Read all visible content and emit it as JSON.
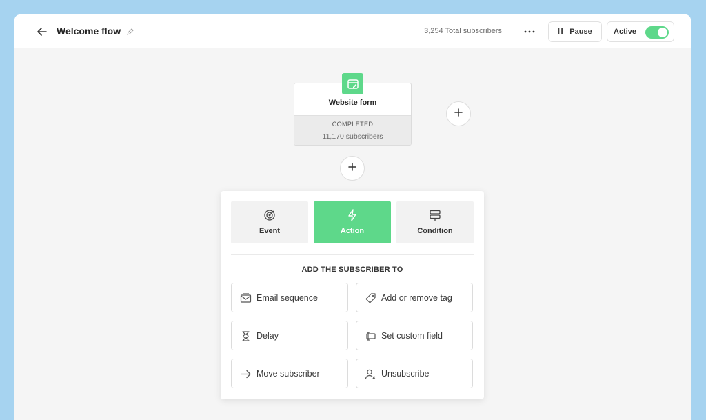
{
  "header": {
    "title": "Welcome flow",
    "subscribers_total": "3,254 Total subscribers",
    "pause_label": "Pause",
    "active_label": "Active",
    "active_on": true
  },
  "trigger": {
    "title": "Website form",
    "status": "COMPLETED",
    "count": "11,170 subscribers"
  },
  "panel": {
    "tabs": [
      {
        "label": "Event",
        "icon": "target-icon",
        "selected": false
      },
      {
        "label": "Action",
        "icon": "lightning-icon",
        "selected": true
      },
      {
        "label": "Condition",
        "icon": "signpost-icon",
        "selected": false
      }
    ],
    "section_title": "ADD THE SUBSCRIBER TO",
    "options": [
      {
        "label": "Email sequence",
        "icon": "email-sequence-icon"
      },
      {
        "label": "Add or remove tag",
        "icon": "tag-icon"
      },
      {
        "label": "Delay",
        "icon": "hourglass-icon"
      },
      {
        "label": "Set custom field",
        "icon": "custom-field-icon"
      },
      {
        "label": "Move subscriber",
        "icon": "arrow-right-icon"
      },
      {
        "label": "Unsubscribe",
        "icon": "user-remove-icon"
      }
    ]
  },
  "colors": {
    "accent": "#5ed88a",
    "background": "#a6d3f0",
    "canvas": "#f5f5f5"
  }
}
